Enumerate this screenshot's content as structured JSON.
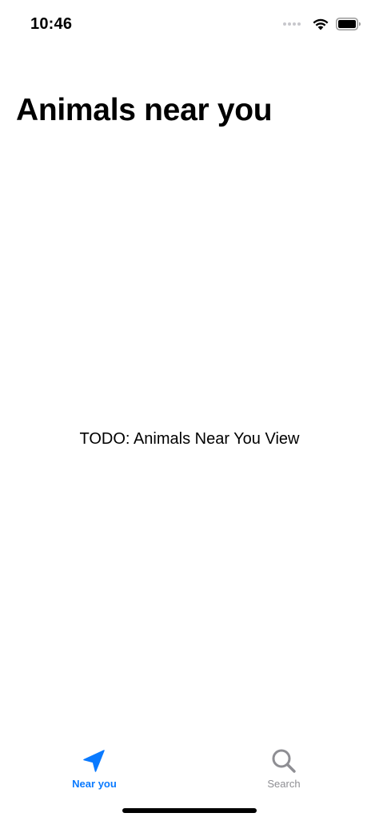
{
  "status_bar": {
    "time": "10:46"
  },
  "title": "Animals near you",
  "content": {
    "placeholder_text": "TODO: Animals Near You View"
  },
  "tab_bar": {
    "tabs": [
      {
        "label": "Near you",
        "icon": "location-arrow-icon",
        "selected": true
      },
      {
        "label": "Search",
        "icon": "magnifying-glass-icon",
        "selected": false
      }
    ]
  },
  "colors": {
    "accent": "#0a7aff",
    "inactive": "#8e8e93"
  }
}
